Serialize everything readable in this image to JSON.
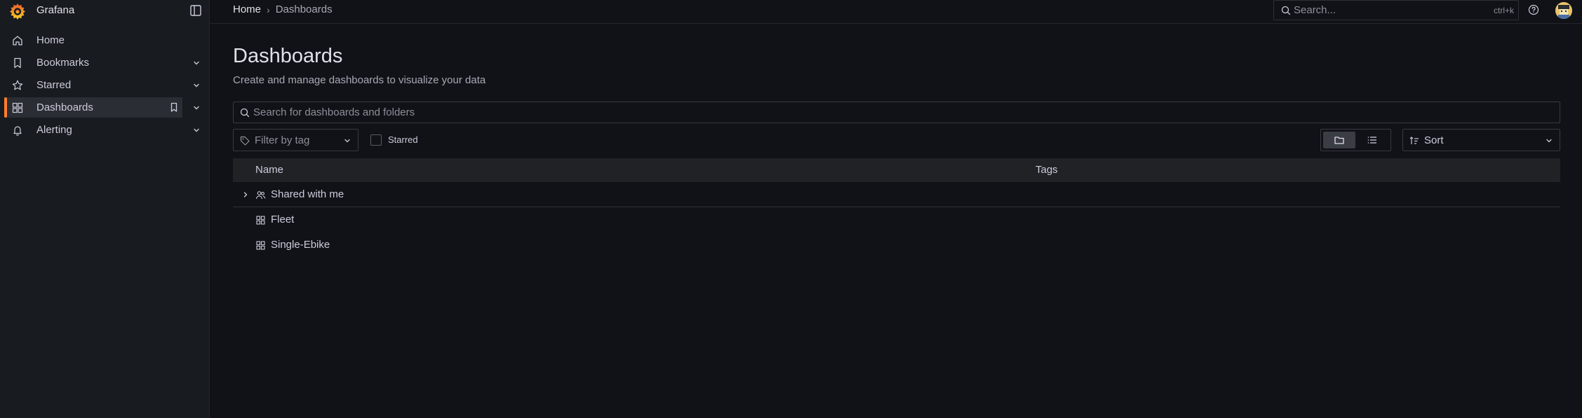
{
  "app": {
    "brand": "Grafana",
    "accent": "#ff7f2b"
  },
  "sidebar": {
    "items": [
      {
        "label": "Home",
        "icon": "home-icon",
        "has_chevron": false,
        "active": false
      },
      {
        "label": "Bookmarks",
        "icon": "bookmark-icon",
        "has_chevron": true,
        "active": false
      },
      {
        "label": "Starred",
        "icon": "star-icon",
        "has_chevron": true,
        "active": false
      },
      {
        "label": "Dashboards",
        "icon": "apps-grid-icon",
        "has_chevron": true,
        "active": true
      },
      {
        "label": "Alerting",
        "icon": "bell-icon",
        "has_chevron": true,
        "active": false
      }
    ]
  },
  "breadcrumb": {
    "home": "Home",
    "separator": "›",
    "current": "Dashboards"
  },
  "top_search": {
    "placeholder": "Search...",
    "shortcut": "ctrl+k"
  },
  "page": {
    "title": "Dashboards",
    "subtitle": "Create and manage dashboards to visualize your data"
  },
  "filters": {
    "search_placeholder": "Search for dashboards and folders",
    "tag_placeholder": "Filter by tag",
    "starred_label": "Starred",
    "sort_label": "Sort",
    "view_mode": "folder"
  },
  "table": {
    "columns": {
      "name": "Name",
      "tags": "Tags"
    },
    "rows": [
      {
        "name": "Shared with me",
        "icon": "users-icon",
        "expandable": true
      },
      {
        "name": "Fleet",
        "icon": "apps-grid-icon",
        "expandable": false
      },
      {
        "name": "Single-Ebike",
        "icon": "apps-grid-icon",
        "expandable": false
      }
    ]
  }
}
